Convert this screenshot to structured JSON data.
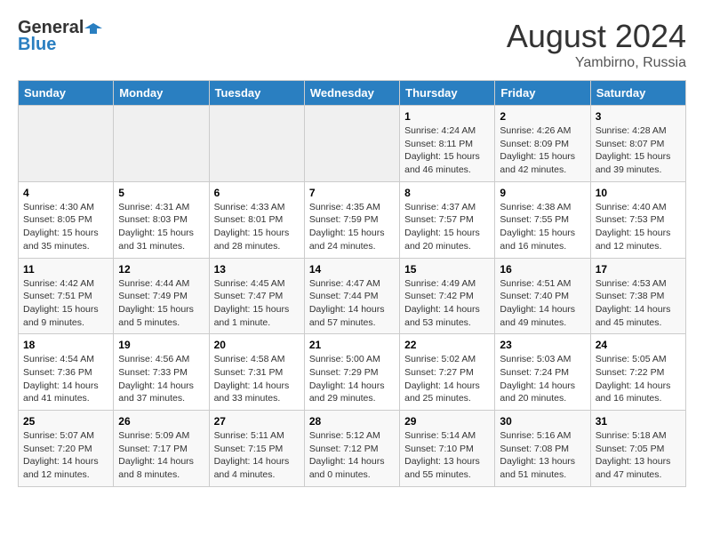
{
  "header": {
    "logo_general": "General",
    "logo_blue": "Blue",
    "month_year": "August 2024",
    "location": "Yambirno, Russia"
  },
  "days_of_week": [
    "Sunday",
    "Monday",
    "Tuesday",
    "Wednesday",
    "Thursday",
    "Friday",
    "Saturday"
  ],
  "weeks": [
    [
      {
        "day": "",
        "content": ""
      },
      {
        "day": "",
        "content": ""
      },
      {
        "day": "",
        "content": ""
      },
      {
        "day": "",
        "content": ""
      },
      {
        "day": "1",
        "content": "Sunrise: 4:24 AM\nSunset: 8:11 PM\nDaylight: 15 hours\nand 46 minutes."
      },
      {
        "day": "2",
        "content": "Sunrise: 4:26 AM\nSunset: 8:09 PM\nDaylight: 15 hours\nand 42 minutes."
      },
      {
        "day": "3",
        "content": "Sunrise: 4:28 AM\nSunset: 8:07 PM\nDaylight: 15 hours\nand 39 minutes."
      }
    ],
    [
      {
        "day": "4",
        "content": "Sunrise: 4:30 AM\nSunset: 8:05 PM\nDaylight: 15 hours\nand 35 minutes."
      },
      {
        "day": "5",
        "content": "Sunrise: 4:31 AM\nSunset: 8:03 PM\nDaylight: 15 hours\nand 31 minutes."
      },
      {
        "day": "6",
        "content": "Sunrise: 4:33 AM\nSunset: 8:01 PM\nDaylight: 15 hours\nand 28 minutes."
      },
      {
        "day": "7",
        "content": "Sunrise: 4:35 AM\nSunset: 7:59 PM\nDaylight: 15 hours\nand 24 minutes."
      },
      {
        "day": "8",
        "content": "Sunrise: 4:37 AM\nSunset: 7:57 PM\nDaylight: 15 hours\nand 20 minutes."
      },
      {
        "day": "9",
        "content": "Sunrise: 4:38 AM\nSunset: 7:55 PM\nDaylight: 15 hours\nand 16 minutes."
      },
      {
        "day": "10",
        "content": "Sunrise: 4:40 AM\nSunset: 7:53 PM\nDaylight: 15 hours\nand 12 minutes."
      }
    ],
    [
      {
        "day": "11",
        "content": "Sunrise: 4:42 AM\nSunset: 7:51 PM\nDaylight: 15 hours\nand 9 minutes."
      },
      {
        "day": "12",
        "content": "Sunrise: 4:44 AM\nSunset: 7:49 PM\nDaylight: 15 hours\nand 5 minutes."
      },
      {
        "day": "13",
        "content": "Sunrise: 4:45 AM\nSunset: 7:47 PM\nDaylight: 15 hours\nand 1 minute."
      },
      {
        "day": "14",
        "content": "Sunrise: 4:47 AM\nSunset: 7:44 PM\nDaylight: 14 hours\nand 57 minutes."
      },
      {
        "day": "15",
        "content": "Sunrise: 4:49 AM\nSunset: 7:42 PM\nDaylight: 14 hours\nand 53 minutes."
      },
      {
        "day": "16",
        "content": "Sunrise: 4:51 AM\nSunset: 7:40 PM\nDaylight: 14 hours\nand 49 minutes."
      },
      {
        "day": "17",
        "content": "Sunrise: 4:53 AM\nSunset: 7:38 PM\nDaylight: 14 hours\nand 45 minutes."
      }
    ],
    [
      {
        "day": "18",
        "content": "Sunrise: 4:54 AM\nSunset: 7:36 PM\nDaylight: 14 hours\nand 41 minutes."
      },
      {
        "day": "19",
        "content": "Sunrise: 4:56 AM\nSunset: 7:33 PM\nDaylight: 14 hours\nand 37 minutes."
      },
      {
        "day": "20",
        "content": "Sunrise: 4:58 AM\nSunset: 7:31 PM\nDaylight: 14 hours\nand 33 minutes."
      },
      {
        "day": "21",
        "content": "Sunrise: 5:00 AM\nSunset: 7:29 PM\nDaylight: 14 hours\nand 29 minutes."
      },
      {
        "day": "22",
        "content": "Sunrise: 5:02 AM\nSunset: 7:27 PM\nDaylight: 14 hours\nand 25 minutes."
      },
      {
        "day": "23",
        "content": "Sunrise: 5:03 AM\nSunset: 7:24 PM\nDaylight: 14 hours\nand 20 minutes."
      },
      {
        "day": "24",
        "content": "Sunrise: 5:05 AM\nSunset: 7:22 PM\nDaylight: 14 hours\nand 16 minutes."
      }
    ],
    [
      {
        "day": "25",
        "content": "Sunrise: 5:07 AM\nSunset: 7:20 PM\nDaylight: 14 hours\nand 12 minutes."
      },
      {
        "day": "26",
        "content": "Sunrise: 5:09 AM\nSunset: 7:17 PM\nDaylight: 14 hours\nand 8 minutes."
      },
      {
        "day": "27",
        "content": "Sunrise: 5:11 AM\nSunset: 7:15 PM\nDaylight: 14 hours\nand 4 minutes."
      },
      {
        "day": "28",
        "content": "Sunrise: 5:12 AM\nSunset: 7:12 PM\nDaylight: 14 hours\nand 0 minutes."
      },
      {
        "day": "29",
        "content": "Sunrise: 5:14 AM\nSunset: 7:10 PM\nDaylight: 13 hours\nand 55 minutes."
      },
      {
        "day": "30",
        "content": "Sunrise: 5:16 AM\nSunset: 7:08 PM\nDaylight: 13 hours\nand 51 minutes."
      },
      {
        "day": "31",
        "content": "Sunrise: 5:18 AM\nSunset: 7:05 PM\nDaylight: 13 hours\nand 47 minutes."
      }
    ]
  ]
}
